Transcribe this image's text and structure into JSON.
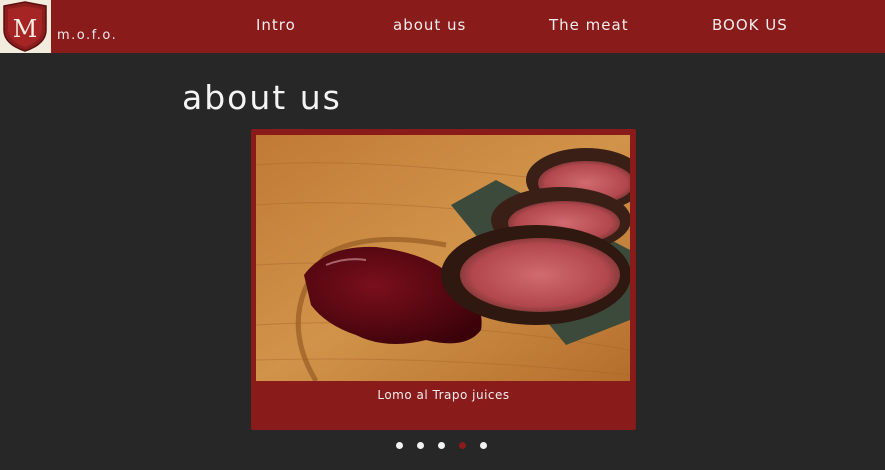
{
  "header": {
    "brand": "m.o.f.o.",
    "logo_letter": "M",
    "nav": [
      {
        "label": "Intro"
      },
      {
        "label": "about us"
      },
      {
        "label": "The meat"
      },
      {
        "label": "BOOK US"
      }
    ]
  },
  "main": {
    "title": "about us",
    "slide_caption": "Lomo al Trapo juices",
    "carousel": {
      "slides": 5,
      "active_index": 3
    }
  },
  "colors": {
    "accent": "#891b1b",
    "background": "#272727",
    "text": "#f4f4f4"
  }
}
